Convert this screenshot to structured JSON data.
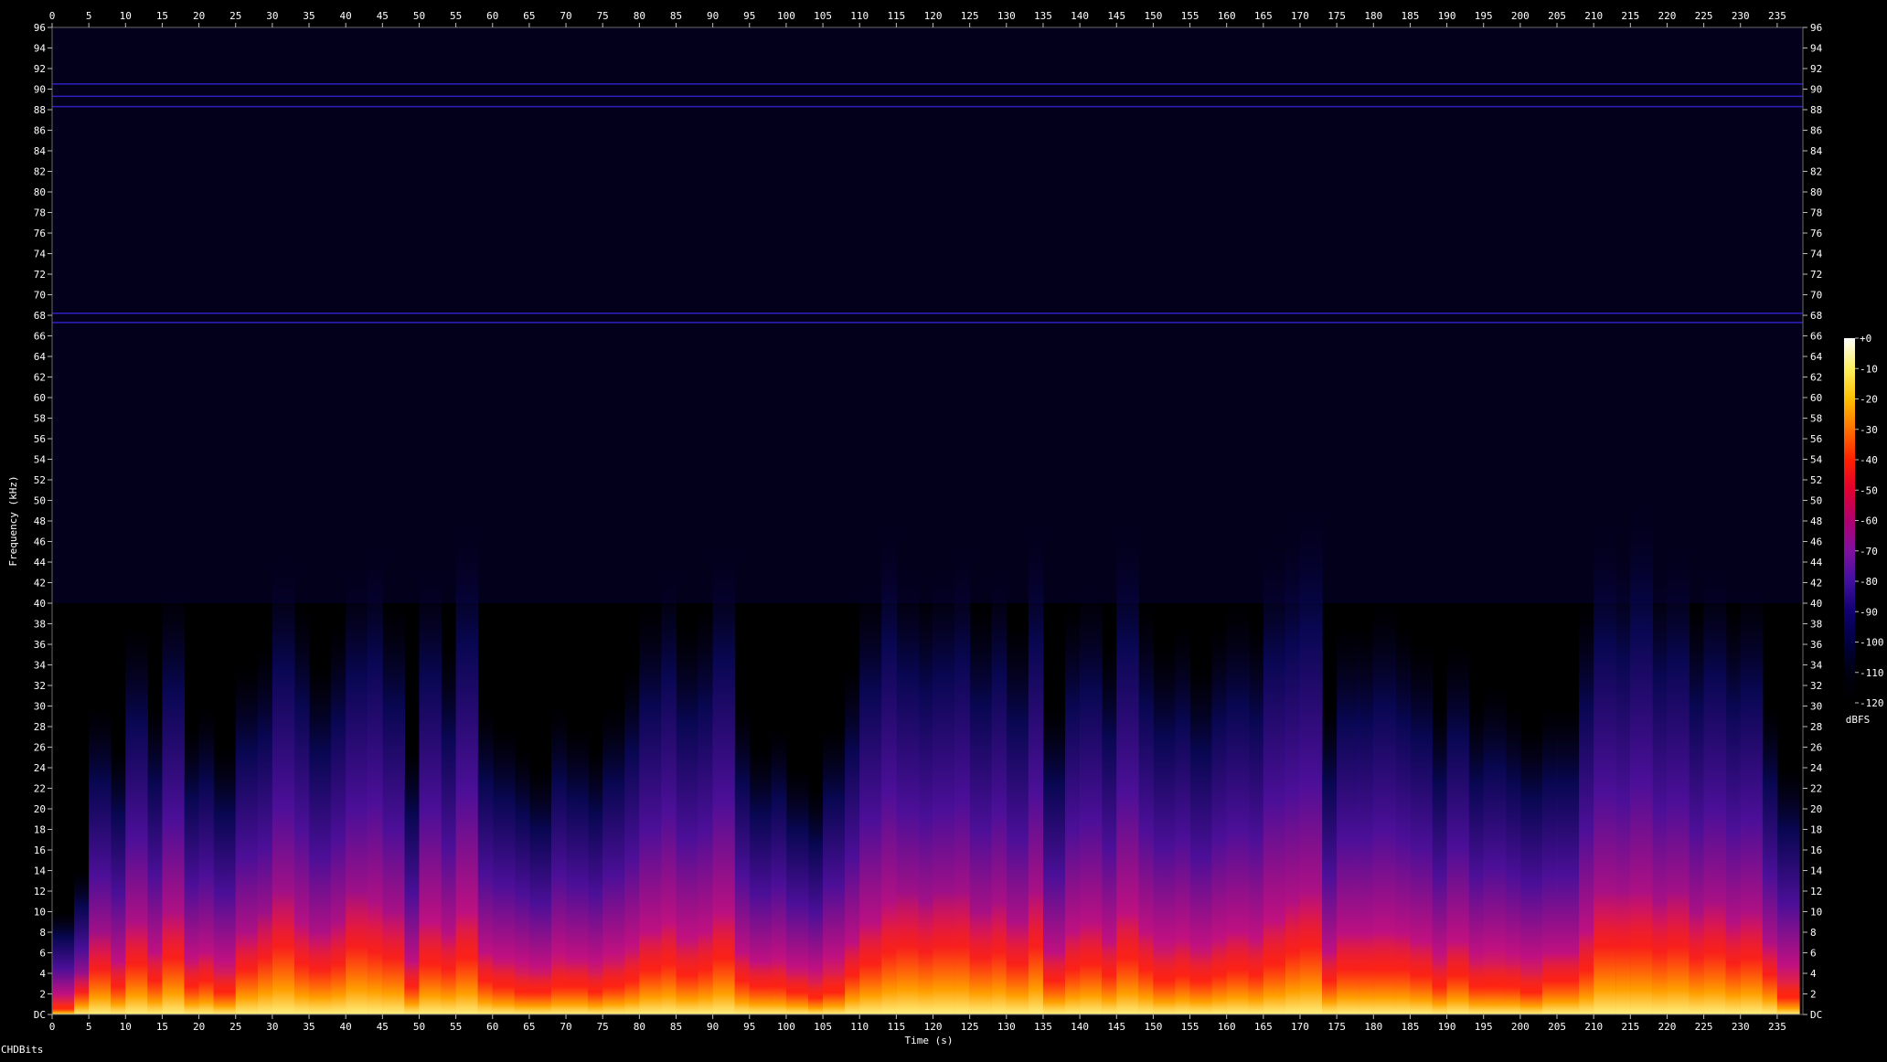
{
  "footer": {
    "label": "CHDBits"
  },
  "chart_data": {
    "type": "heatmap",
    "subtype": "spectrogram",
    "title": "",
    "xlabel": "Time (s)",
    "ylabel": "Frequency (kHz)",
    "xlim": [
      0,
      238.5
    ],
    "ylim": [
      0,
      96
    ],
    "x_ticks": [
      0,
      5,
      10,
      15,
      20,
      25,
      30,
      35,
      40,
      45,
      50,
      55,
      60,
      65,
      70,
      75,
      80,
      85,
      90,
      95,
      100,
      105,
      110,
      115,
      120,
      125,
      130,
      135,
      140,
      145,
      150,
      155,
      160,
      165,
      170,
      175,
      180,
      185,
      190,
      195,
      200,
      205,
      210,
      215,
      220,
      225,
      230,
      235
    ],
    "y_ticks": [
      0,
      2,
      4,
      6,
      8,
      10,
      12,
      14,
      16,
      18,
      20,
      22,
      24,
      26,
      28,
      30,
      32,
      34,
      36,
      38,
      40,
      42,
      44,
      46,
      48,
      50,
      52,
      54,
      56,
      58,
      60,
      62,
      64,
      66,
      68,
      70,
      72,
      74,
      76,
      78,
      80,
      82,
      84,
      86,
      88,
      90,
      92,
      94,
      96
    ],
    "y_zero_label": "DC",
    "colorbar": {
      "label": "dBFS",
      "range": [
        -120,
        0
      ],
      "ticks": [
        "+0",
        "-10",
        "-20",
        "-30",
        "-40",
        "-50",
        "-60",
        "-70",
        "-80",
        "-90",
        "-100",
        "-110",
        "-120"
      ],
      "colors": [
        "#ffffff",
        "#fff060",
        "#ffc000",
        "#ff7000",
        "#ff2000",
        "#e00030",
        "#b00070",
        "#8010a0",
        "#4010a0",
        "#100070",
        "#000040",
        "#000010",
        "#000000"
      ]
    },
    "horizontal_lines_khz": [
      90.5,
      89.3,
      88.3,
      68.2,
      67.3
    ],
    "line_color": "#3020c0",
    "energy_profile": {
      "x": [
        0,
        3,
        5,
        8,
        10,
        13,
        15,
        18,
        20,
        22,
        25,
        28,
        30,
        33,
        35,
        38,
        40,
        43,
        45,
        48,
        50,
        53,
        55,
        58,
        60,
        63,
        65,
        68,
        70,
        73,
        75,
        78,
        80,
        83,
        85,
        88,
        90,
        93,
        95,
        98,
        100,
        103,
        105,
        108,
        110,
        113,
        115,
        118,
        120,
        123,
        125,
        128,
        130,
        133,
        135,
        138,
        140,
        143,
        145,
        148,
        150,
        153,
        155,
        158,
        160,
        163,
        165,
        168,
        170,
        173,
        175,
        178,
        180,
        183,
        185,
        188,
        190,
        193,
        195,
        198,
        200,
        203,
        205,
        208,
        210,
        213,
        215,
        218,
        220,
        223,
        225,
        228,
        230,
        233,
        235,
        238
      ],
      "upper_khz": [
        10,
        14,
        30,
        26,
        38,
        30,
        42,
        28,
        30,
        26,
        34,
        36,
        45,
        40,
        34,
        38,
        44,
        46,
        40,
        26,
        44,
        36,
        48,
        30,
        28,
        26,
        24,
        30,
        28,
        26,
        30,
        34,
        40,
        44,
        38,
        40,
        46,
        30,
        26,
        28,
        24,
        22,
        28,
        34,
        42,
        48,
        44,
        42,
        44,
        46,
        40,
        44,
        38,
        48,
        30,
        40,
        42,
        36,
        48,
        40,
        36,
        38,
        34,
        38,
        40,
        38,
        46,
        48,
        50,
        30,
        38,
        38,
        40,
        38,
        36,
        30,
        36,
        30,
        32,
        30,
        28,
        30,
        30,
        40,
        48,
        46,
        50,
        44,
        46,
        40,
        44,
        40,
        42,
        30,
        24,
        10
      ],
      "hot_khz": [
        1,
        4,
        8,
        5,
        9,
        6,
        10,
        5,
        6,
        4,
        8,
        10,
        12,
        9,
        8,
        9,
        12,
        11,
        10,
        5,
        9,
        8,
        10,
        6,
        5,
        4,
        4,
        5,
        5,
        4,
        5,
        6,
        8,
        9,
        7,
        8,
        10,
        6,
        5,
        5,
        4,
        3,
        4,
        7,
        9,
        11,
        12,
        11,
        12,
        12,
        10,
        11,
        9,
        12,
        6,
        8,
        9,
        7,
        10,
        8,
        6,
        7,
        6,
        7,
        8,
        7,
        9,
        11,
        12,
        6,
        8,
        8,
        8,
        8,
        7,
        5,
        7,
        5,
        5,
        5,
        4,
        6,
        6,
        8,
        12,
        12,
        12,
        11,
        12,
        10,
        11,
        9,
        10,
        7,
        3,
        1
      ]
    }
  }
}
